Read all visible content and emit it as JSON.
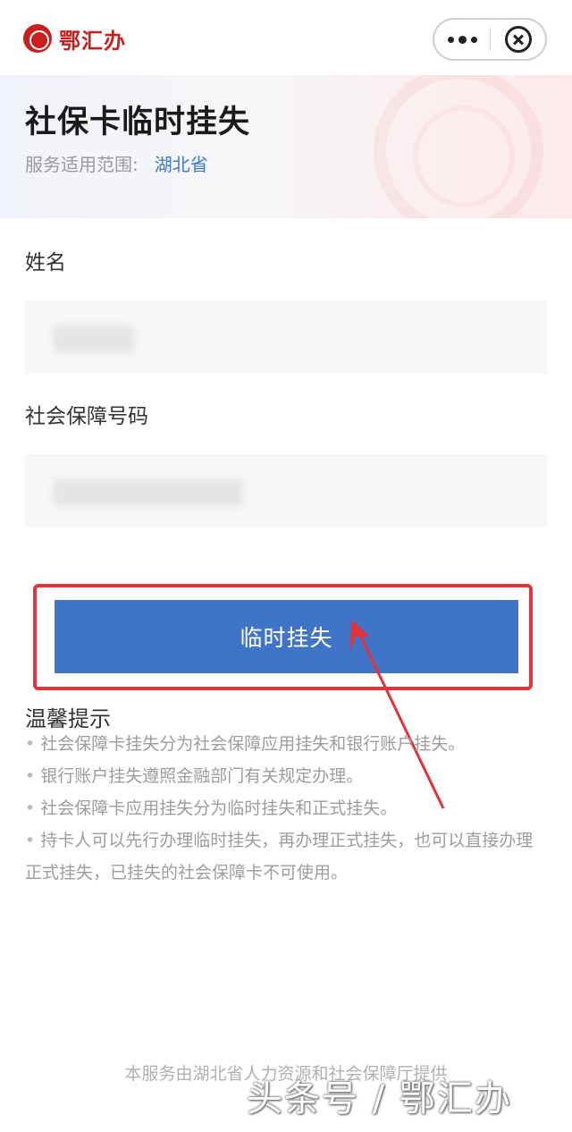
{
  "app": {
    "logo_text": "鄂汇办"
  },
  "header": {
    "title": "社保卡临时挂失",
    "scope_label": "服务适用范围:",
    "scope_value": "湖北省"
  },
  "form": {
    "name_label": "姓名",
    "name_value": "",
    "ssn_label": "社会保障号码",
    "ssn_value": ""
  },
  "action": {
    "submit_label": "临时挂失"
  },
  "tips": {
    "title": "温馨提示",
    "items": [
      "社会保障卡挂失分为社会保障应用挂失和银行账户挂失。",
      "银行账户挂失遵照金融部门有关规定办理。",
      "社会保障卡应用挂失分为临时挂失和正式挂失。",
      "持卡人可以先行办理临时挂失，再办理正式挂失，也可以直接办理正式挂失，已挂失的社会保障卡不可使用。"
    ],
    "bullet": "•"
  },
  "footer": {
    "provider_text": "本服务由湖北省人力资源和社会保障厅提供",
    "watermark": "头条号 / 鄂汇办"
  },
  "colors": {
    "primary": "#3f74c8",
    "annotation": "#e0333a",
    "logo": "#c8201f",
    "scope_link": "#3d7ac7"
  }
}
